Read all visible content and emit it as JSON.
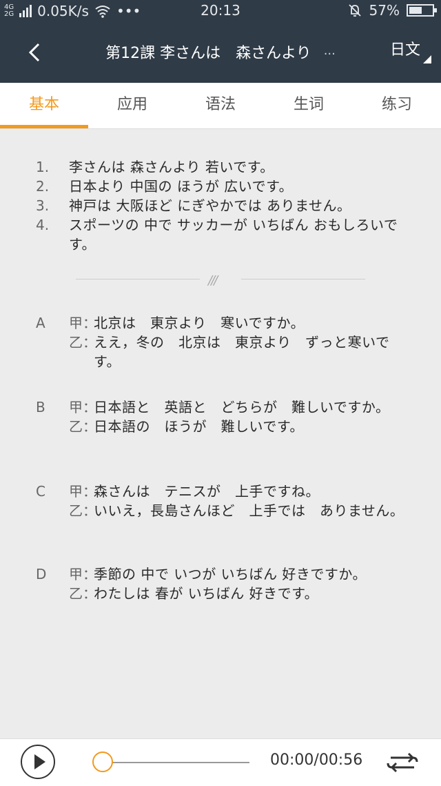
{
  "statusbar": {
    "network_top": "4G",
    "network_bottom": "2G",
    "speed": "0.05K/s",
    "dots": "•••",
    "time": "20:13",
    "battery": "57%",
    "battery_level": 0.57
  },
  "header": {
    "title": "第12課 李さんは　森さんより",
    "more": "···",
    "lang": "日文"
  },
  "tabs": [
    "基本",
    "应用",
    "语法",
    "生词",
    "练习"
  ],
  "sentences": [
    {
      "num": "1.",
      "text": "李さんは 森さんより 若いです。"
    },
    {
      "num": "2.",
      "text": "日本より 中国の ほうが 広いです。"
    },
    {
      "num": "3.",
      "text": "神戸は 大阪ほど にぎやかでは ありません。"
    },
    {
      "num": "4.",
      "text": "スポーツの 中で サッカーが いちばん おもしろいです。"
    }
  ],
  "divider_mark": "///",
  "dialogues": [
    {
      "letter": "A",
      "lines": [
        {
          "speaker": "甲：",
          "text": "北京は　東京より　寒いですか。"
        },
        {
          "speaker": "乙：",
          "text": "ええ，冬の　北京は　東京より　ずっと寒いです。"
        }
      ]
    },
    {
      "letter": "B",
      "lines": [
        {
          "speaker": "甲：",
          "text": "日本語と　英語と　どちらが　難しいですか。"
        },
        {
          "speaker": "乙：",
          "text": "日本語の　ほうが　難しいです。"
        }
      ]
    },
    {
      "letter": "C",
      "lines": [
        {
          "speaker": "甲：",
          "text": "森さんは　テニスが　上手ですね。"
        },
        {
          "speaker": "乙：",
          "text": "いいえ，長島さんほど　上手では　ありません。"
        }
      ]
    },
    {
      "letter": "D",
      "lines": [
        {
          "speaker": "甲：",
          "text": "季節の 中で いつが いちばん 好きですか。"
        },
        {
          "speaker": "乙：",
          "text": "わたしは 春が いちばん 好きです。"
        }
      ]
    }
  ],
  "player": {
    "time": "00:00/00:56",
    "progress": 0
  },
  "colors": {
    "header_bg": "#2f3b47",
    "accent": "#f29a1c",
    "content_bg": "#ececec"
  }
}
